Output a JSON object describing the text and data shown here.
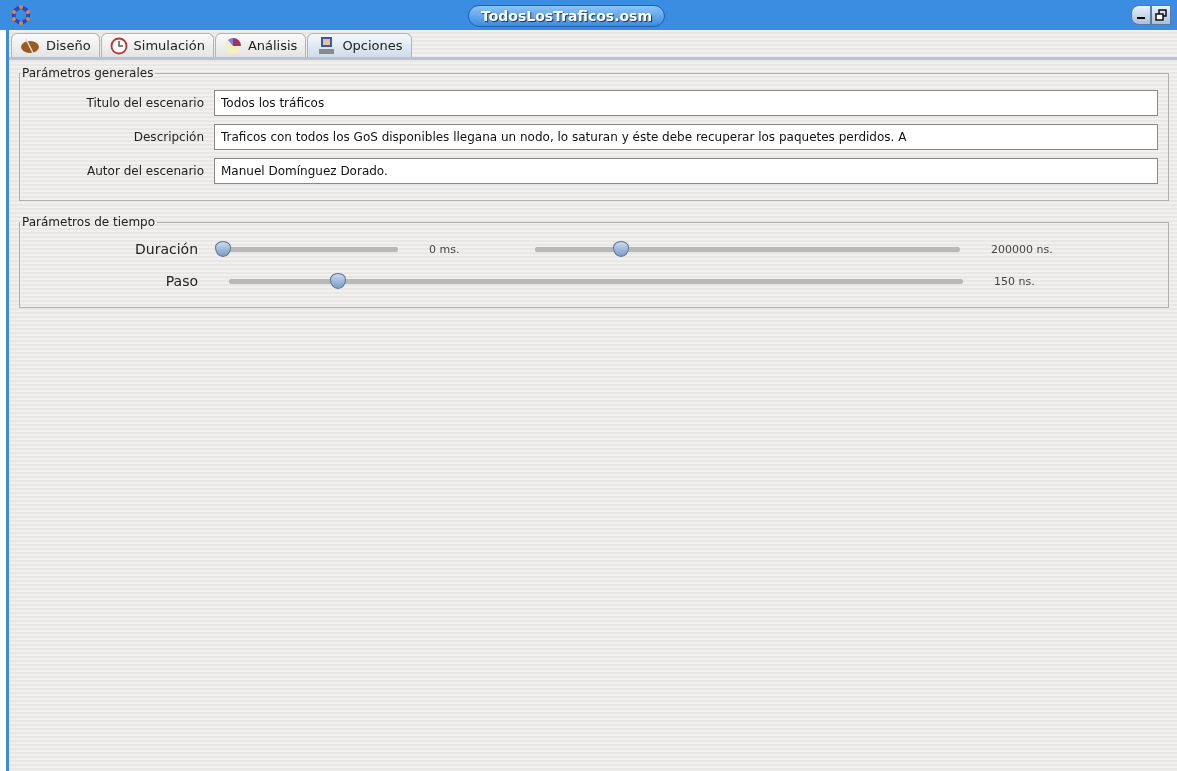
{
  "window": {
    "title": "TodosLosTraficos.osm"
  },
  "tabs": [
    {
      "label": "Diseño",
      "selected": false
    },
    {
      "label": "Simulación",
      "selected": false
    },
    {
      "label": "Análisis",
      "selected": false
    },
    {
      "label": "Opciones",
      "selected": true
    }
  ],
  "general": {
    "title": "Parámetros generales",
    "fields": [
      {
        "label": "Titulo del escenario",
        "value": "Todos los tráficos"
      },
      {
        "label": "Descripción",
        "value": "Traficos con todos los GoS disponibles llegana un nodo, lo saturan y éste debe recuperar los paquetes perdidos. A"
      },
      {
        "label": "Autor del escenario",
        "value": "Manuel Domínguez Dorado."
      }
    ]
  },
  "time": {
    "title": "Parámetros de tiempo",
    "rows": [
      {
        "label": "Duración",
        "sliders": [
          {
            "level": 0,
            "reading": "0 ms."
          },
          {
            "level": 0.2,
            "reading": "200000 ns."
          }
        ]
      },
      {
        "label": "Paso",
        "sliders": [
          {
            "level": 0.147,
            "reading": "150 ns."
          }
        ]
      }
    ]
  }
}
